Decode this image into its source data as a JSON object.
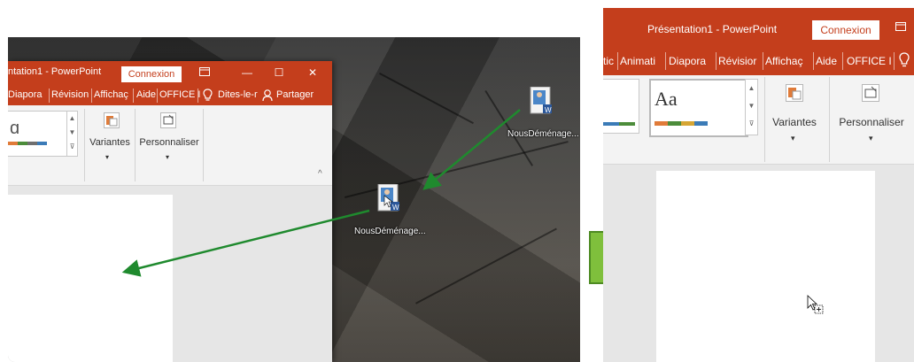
{
  "left_window": {
    "title": "ntation1 - PowerPoint",
    "connexion": "Connexion",
    "tabs": [
      "Diapora",
      "Révision",
      "Affichaç",
      "Aide",
      "OFFICE I",
      "Dites-le-r",
      "Partager"
    ],
    "ribbon": {
      "variantes": "Variantes",
      "personnaliser": "Personnaliser",
      "theme_sample": "ɑ"
    }
  },
  "desktop": {
    "icon_top_label": "NousDéménage...",
    "icon_drag_label": "NousDéménage..."
  },
  "right_window": {
    "title": "Présentation1  -  PowerPoint",
    "connexion": "Connexion",
    "tabs": [
      "tic",
      "Animati",
      "Diapora",
      "Révisior",
      "Affichaç",
      "Aide",
      "OFFICE I"
    ],
    "ribbon": {
      "theme_sample": "Aa",
      "variantes": "Variantes",
      "personnaliser": "Personnaliser"
    }
  },
  "colors": {
    "accent": "#c43e1c",
    "arrow_green": "#1f8a2e",
    "big_arrow": "#7fbf3c"
  }
}
